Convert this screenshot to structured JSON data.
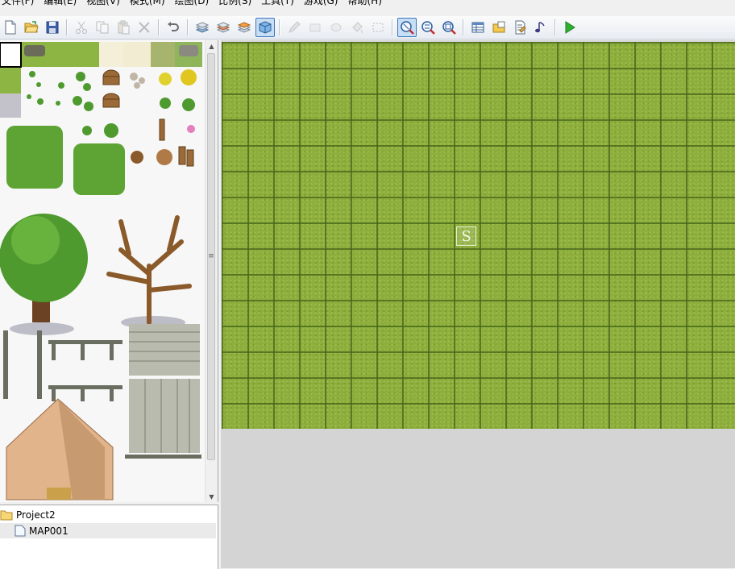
{
  "menu": [
    "文件(F)",
    "编辑(E)",
    "视图(V)",
    "模式(M)",
    "绘图(D)",
    "比例(S)",
    "工具(T)",
    "游戏(G)",
    "帮助(H)"
  ],
  "toolbar_icons": [
    "new-file-icon",
    "open-folder-icon",
    "save-icon",
    "cut-icon",
    "copy-icon",
    "paste-icon",
    "delete-icon",
    "undo-icon",
    "layer-1-icon",
    "layer-2-icon",
    "layer-3-icon",
    "event-layer-icon",
    "pencil-icon",
    "rectangle-icon",
    "ellipse-icon",
    "fill-icon",
    "select-icon",
    "zoom-1-icon",
    "zoom-2-icon",
    "zoom-4-icon",
    "database-icon",
    "resource-manager-icon",
    "script-editor-icon",
    "sound-test-icon",
    "play-test-icon"
  ],
  "tree": {
    "project": "Project2",
    "map": "MAP001"
  },
  "map": {
    "start_marker": "S",
    "grass_color": "#8dae3d",
    "background_color": "#d4d4d4"
  }
}
